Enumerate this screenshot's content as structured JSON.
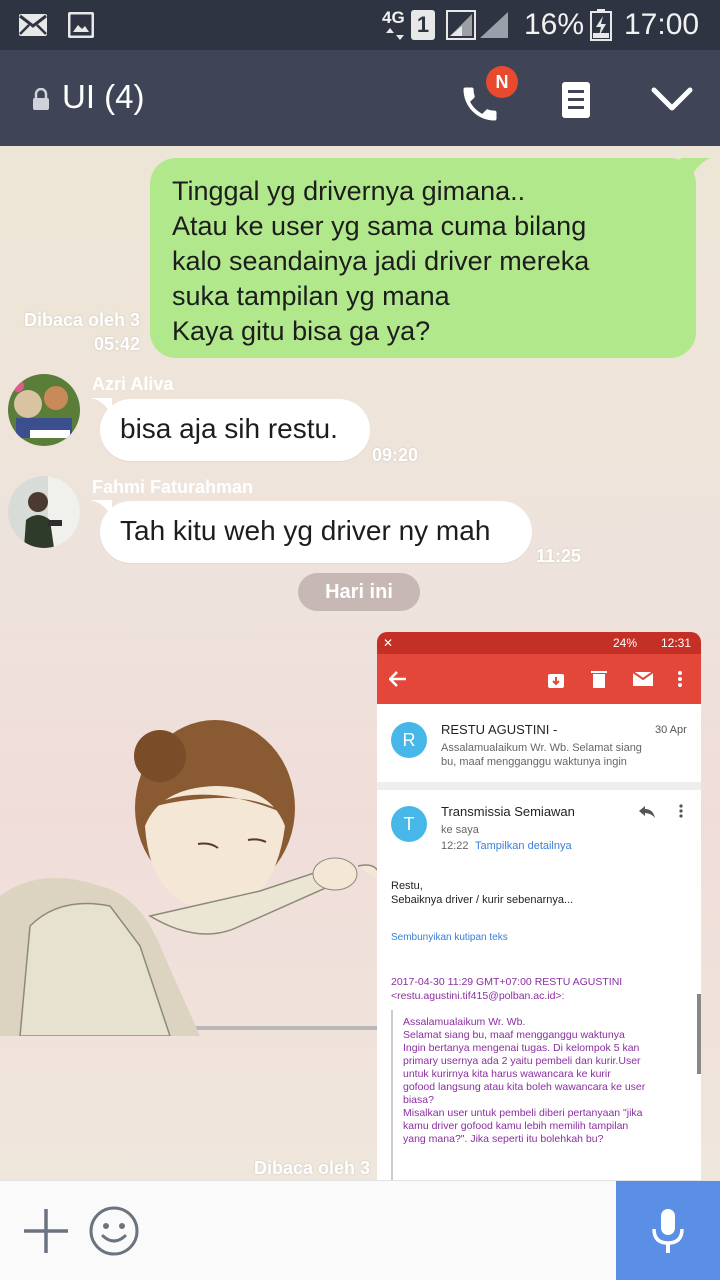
{
  "status_bar": {
    "network": "4G",
    "sim": "1",
    "battery": "16%",
    "time": "17:00",
    "icons": [
      "mail-icon",
      "image-icon",
      "signal-icon",
      "battery-charging-icon"
    ]
  },
  "header": {
    "title": "UI (4)",
    "call_badge": "N",
    "icons": [
      "lock-icon",
      "phone-icon",
      "notes-icon",
      "chevron-down-icon"
    ]
  },
  "messages": {
    "outgoing_1": {
      "lines": [
        "Tinggal yg drivernya gimana..",
        "Atau ke user yg sama cuma bilang",
        "kalo seandainya jadi driver mereka",
        "suka tampilan yg mana",
        "Kaya gitu bisa ga ya?"
      ],
      "read": "Dibaca oleh 3",
      "time": "05:42"
    },
    "incoming_1": {
      "sender": "Azri Aliva",
      "text": "bisa aja sih restu.",
      "time": "09:20"
    },
    "incoming_2": {
      "sender": "Fahmi Faturahman",
      "text": "Tah kitu weh yg driver ny mah",
      "time": "11:25"
    },
    "date_divider": "Hari ini",
    "outgoing_image": {
      "read": "Dibaca oleh 3"
    }
  },
  "screenshot": {
    "status_battery": "24%",
    "status_time": "12:31",
    "email_1": {
      "avatar": "R",
      "sender": "RESTU AGUSTINI -",
      "date": "30 Apr",
      "preview_1": "Assalamualaikum Wr. Wb. Selamat siang",
      "preview_2": "bu, maaf mengganggu waktunya ingin"
    },
    "email_2": {
      "avatar": "T",
      "sender": "Transmissia Semiawan",
      "to": "ke saya",
      "time": "12:22",
      "details": "Tampilkan detailnya",
      "greeting": "Restu,",
      "body": "Sebaiknya driver / kurir sebenarnya...",
      "hide_quote": "Sembunyikan kutipan teks",
      "quote_header_1": "2017-04-30 11:29 GMT+07:00 RESTU AGUSTINI",
      "quote_header_2": "<restu.agustini.tif415@polban.ac.id>:",
      "quote_lines": [
        "Assalamualaikum Wr. Wb.",
        "Selamat siang bu, maaf mengganggu waktunya",
        "Ingin bertanya mengenai tugas. Di kelompok 5 kan",
        "primary usernya ada 2 yaitu pembeli dan kurir.User",
        "untuk kurirnya kita harus wawancara ke kurir",
        "gofood langsung atau kita boleh wawancara ke user",
        "biasa?",
        "Misalkan user untuk pembeli diberi pertanyaan \"jika",
        "kamu driver gofood kamu lebih memilih tampilan",
        "yang mana?\". Jika seperti itu bolehkah bu?"
      ]
    }
  },
  "input_bar": {
    "icons": [
      "plus-icon",
      "emoji-icon",
      "microphone-icon"
    ]
  },
  "colors": {
    "header": "#3f4557",
    "status_bar": "#2f3442",
    "outgoing_bubble": "#b1e88c",
    "incoming_bubble": "#ffffff",
    "mic_button": "#5b8fe6",
    "badge": "#e84a2e"
  }
}
